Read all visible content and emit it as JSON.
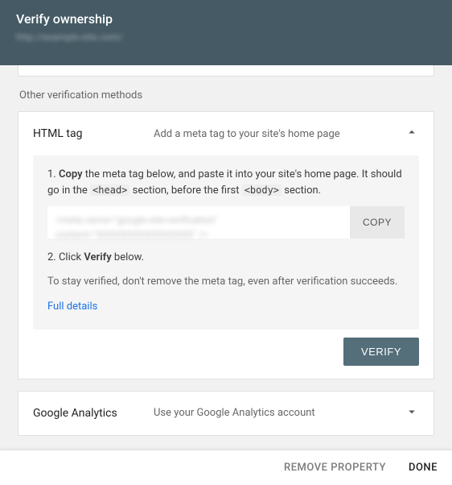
{
  "header": {
    "title": "Verify ownership",
    "subtitle": "http://example-site.com/"
  },
  "section_heading": "Other verification methods",
  "methods": {
    "html_tag": {
      "title": "HTML tag",
      "description": "Add a meta tag to your site's home page",
      "step1_prefix": "1. ",
      "step1_bold": "Copy",
      "step1_text_a": " the meta tag below, and paste it into your site's home page. It should go in the ",
      "step1_code1": "<head>",
      "step1_text_b": " section, before the first ",
      "step1_code2": "<body>",
      "step1_text_c": " section.",
      "meta_value": "<meta name=\"google-site-verification\" content=\"XXXXXXXXXXXXXXXX\" />",
      "copy_label": "COPY",
      "step2_prefix": "2. Click ",
      "step2_bold": "Verify",
      "step2_suffix": " below.",
      "note": "To stay verified, don't remove the meta tag, even after verification succeeds.",
      "details_link": "Full details",
      "verify_label": "VERIFY"
    },
    "analytics": {
      "title": "Google Analytics",
      "description": "Use your Google Analytics account"
    }
  },
  "footer": {
    "remove": "REMOVE PROPERTY",
    "done": "DONE"
  }
}
